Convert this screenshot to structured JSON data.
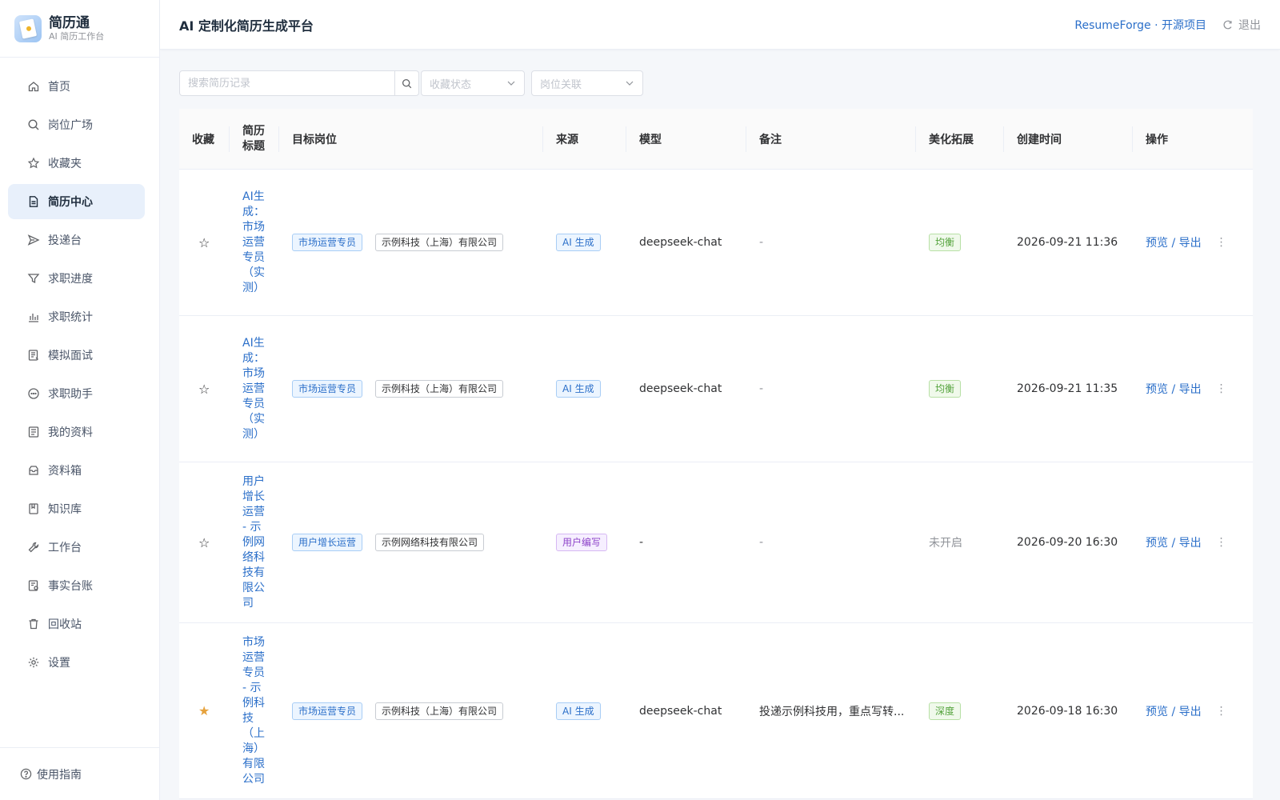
{
  "brand": {
    "title": "简历通",
    "subtitle": "AI 简历工作台"
  },
  "nav": [
    {
      "label": "首页",
      "icon": "home-icon"
    },
    {
      "label": "岗位广场",
      "icon": "search-icon"
    },
    {
      "label": "收藏夹",
      "icon": "star-icon"
    },
    {
      "label": "简历中心",
      "icon": "document-icon",
      "active": true
    },
    {
      "label": "投递台",
      "icon": "send-icon"
    },
    {
      "label": "求职进度",
      "icon": "funnel-icon"
    },
    {
      "label": "求职统计",
      "icon": "bar-chart-icon"
    },
    {
      "label": "模拟面试",
      "icon": "interview-icon"
    },
    {
      "label": "求职助手",
      "icon": "chat-icon"
    },
    {
      "label": "我的资料",
      "icon": "profile-icon"
    },
    {
      "label": "资料箱",
      "icon": "inbox-icon"
    },
    {
      "label": "知识库",
      "icon": "book-icon"
    },
    {
      "label": "工作台",
      "icon": "wrench-icon"
    },
    {
      "label": "事实台账",
      "icon": "ledger-icon"
    },
    {
      "label": "回收站",
      "icon": "trash-icon"
    },
    {
      "label": "设置",
      "icon": "gear-icon"
    }
  ],
  "footer": {
    "guide": "使用指南"
  },
  "header": {
    "title": "AI 定制化简历生成平台",
    "project_link": "ResumeForge · 开源项目",
    "logout": "退出"
  },
  "filters": {
    "search_placeholder": "搜索简历记录",
    "fav_status": "收藏状态",
    "job_link": "岗位关联"
  },
  "table": {
    "columns": {
      "fav": "收藏",
      "title": "简历标题",
      "target": "目标岗位",
      "source": "来源",
      "model": "模型",
      "note": "备注",
      "beauty": "美化拓展",
      "created": "创建时间",
      "ops": "操作"
    },
    "rows": [
      {
        "starred": false,
        "title": "AI生成：市场运营专员（实测）",
        "role": "市场运营专员",
        "company": "示例科技（上海）有限公司",
        "source": "AI 生成",
        "model": "deepseek-chat",
        "note": "-",
        "beauty": "均衡",
        "created": "2026-09-21 11:36",
        "op": "预览 / 导出",
        "more": "⋮"
      },
      {
        "starred": false,
        "title": "AI生成：市场运营专员（实测）",
        "role": "市场运营专员",
        "company": "示例科技（上海）有限公司",
        "source": "AI 生成",
        "model": "deepseek-chat",
        "note": "-",
        "beauty": "均衡",
        "created": "2026-09-21 11:35",
        "op": "预览 / 导出",
        "more": "⋮"
      },
      {
        "starred": false,
        "title": "用户增长运营 - 示例网络科技有限公司",
        "role": "用户增长运营",
        "company": "示例网络科技有限公司",
        "source": "用户编写",
        "model": "-",
        "note": "-",
        "beauty": "未开启",
        "created": "2026-09-20 16:30",
        "op": "预览 / 导出",
        "more": "⋮"
      },
      {
        "starred": true,
        "title": "市场运营专员 - 示例科技（上海）有限公司",
        "role": "市场运营专员",
        "company": "示例科技（上海）有限公司",
        "source": "AI 生成",
        "model": "deepseek-chat",
        "note": "投递示例科技用，重点写转...",
        "beauty": "深度",
        "created": "2026-09-18 16:30",
        "op": "预览 / 导出",
        "more": "⋮"
      }
    ]
  },
  "colors": {
    "accent": "#2b6fc9",
    "star_on": "#e6a23c",
    "active_bg": "#e8f0fb"
  }
}
